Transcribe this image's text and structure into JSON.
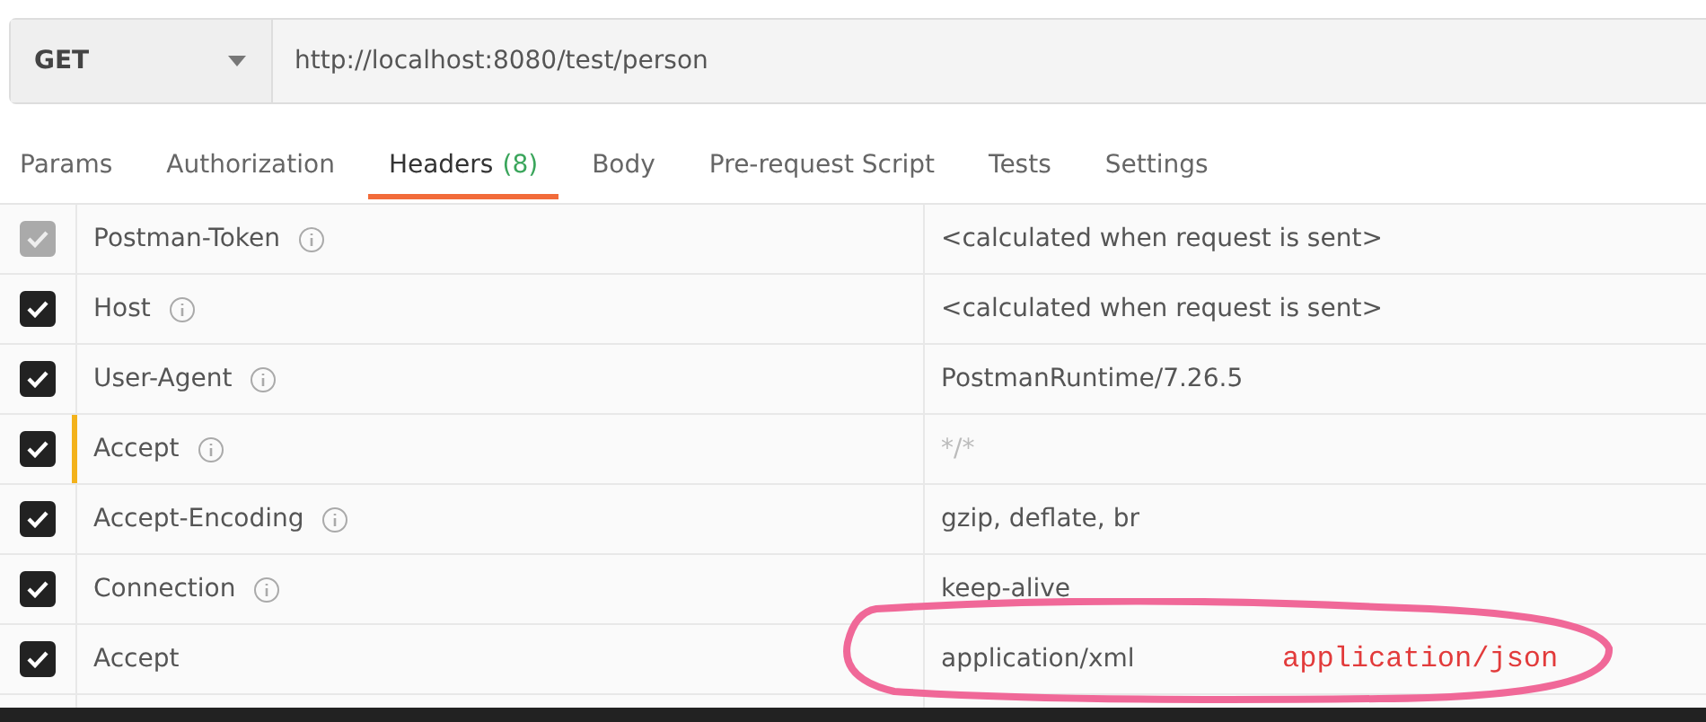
{
  "request": {
    "method": "GET",
    "url": "http://localhost:8080/test/person"
  },
  "tabs": [
    {
      "label": "Params",
      "selected": false
    },
    {
      "label": "Authorization",
      "selected": false
    },
    {
      "label": "Headers",
      "count": "(8)",
      "selected": true
    },
    {
      "label": "Body",
      "selected": false
    },
    {
      "label": "Pre-request Script",
      "selected": false
    },
    {
      "label": "Tests",
      "selected": false
    },
    {
      "label": "Settings",
      "selected": false
    }
  ],
  "headers": [
    {
      "key": "Postman-Token",
      "value": "<calculated when request is sent>",
      "checked": true,
      "locked": true,
      "info": true,
      "overridden": false
    },
    {
      "key": "Host",
      "value": "<calculated when request is sent>",
      "checked": true,
      "locked": false,
      "info": true,
      "overridden": false
    },
    {
      "key": "User-Agent",
      "value": "PostmanRuntime/7.26.5",
      "checked": true,
      "locked": false,
      "info": true,
      "overridden": false
    },
    {
      "key": "Accept",
      "value": "*/*",
      "checked": true,
      "locked": false,
      "info": true,
      "overridden": true
    },
    {
      "key": "Accept-Encoding",
      "value": "gzip, deflate, br",
      "checked": true,
      "locked": false,
      "info": true,
      "overridden": false
    },
    {
      "key": "Connection",
      "value": "keep-alive",
      "checked": true,
      "locked": false,
      "info": true,
      "overridden": false
    },
    {
      "key": "Accept",
      "value": "application/xml",
      "checked": true,
      "locked": false,
      "info": false,
      "overridden": false
    }
  ],
  "annotation": {
    "text": "application/json"
  }
}
